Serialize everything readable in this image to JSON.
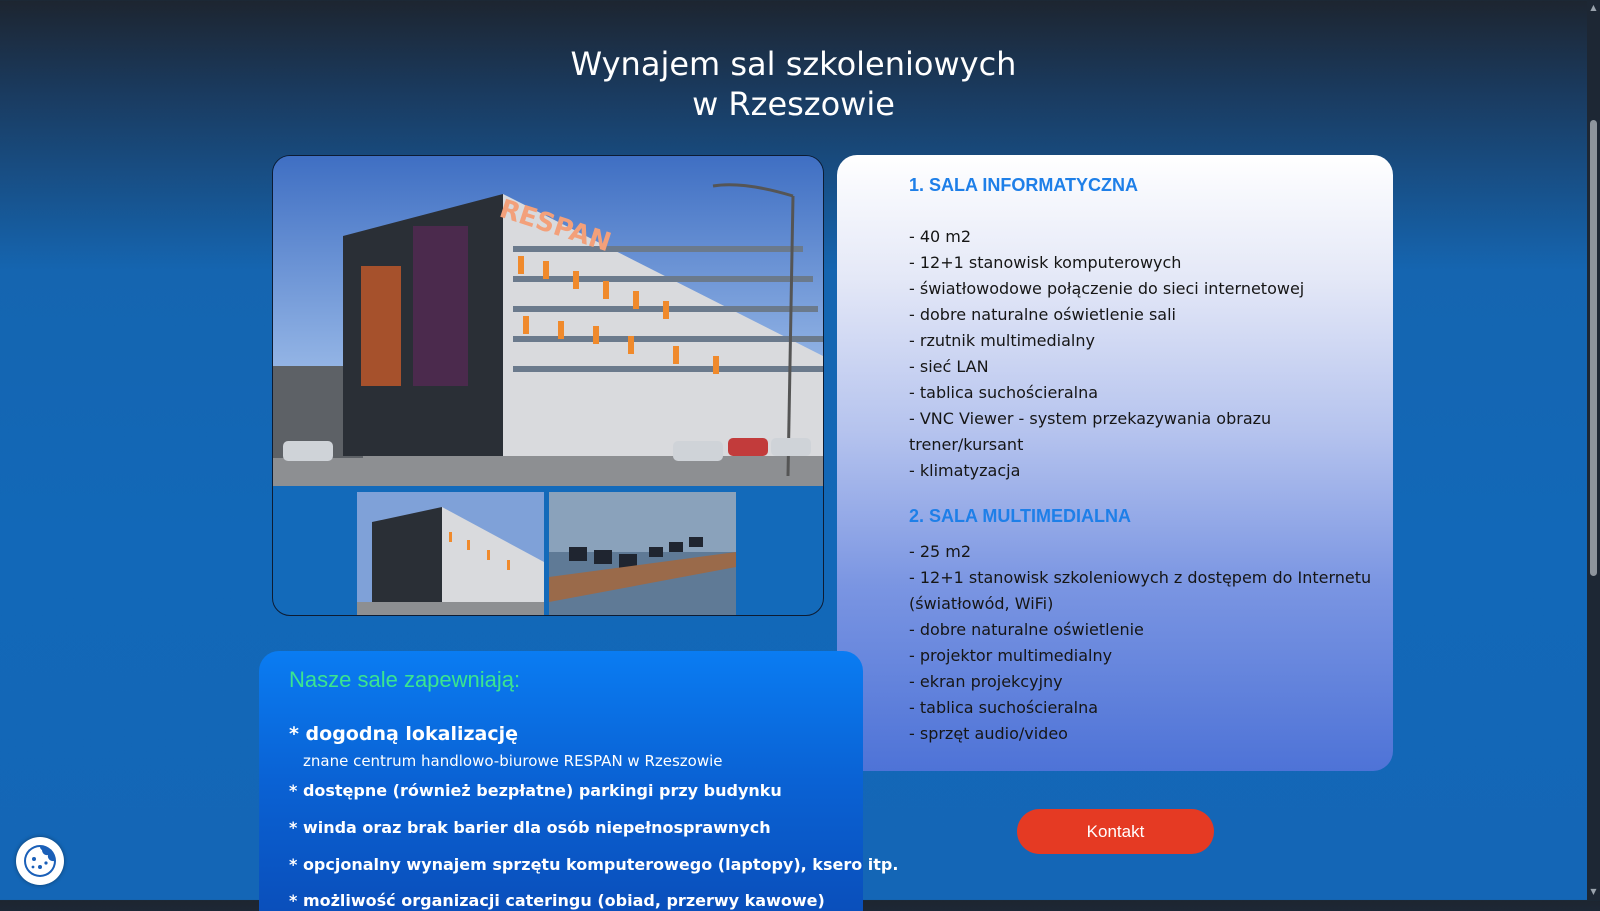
{
  "page": {
    "title_line1": "Wynajem sal szkoleniowych",
    "title_line2": "w Rzeszowie"
  },
  "gallery": {
    "photo_alt": "Budynek RESPAN",
    "building_sign": "RESPAN",
    "thumbnails": [
      "Budynek RESPAN",
      "Sala informatyczna"
    ]
  },
  "sale": [
    {
      "heading": "1. SALA INFORMATYCZNA",
      "features": [
        "- 40 m2",
        "- 12+1 stanowisk komputerowych",
        "- światłowodowe połączenie do sieci internetowej",
        "- dobre naturalne oświetlenie sali",
        "- rzutnik multimedialny",
        "- sieć LAN",
        "- tablica suchościeralna",
        "- VNC Viewer - system przekazywania obrazu trener/kursant",
        "- klimatyzacja"
      ]
    },
    {
      "heading": "2. SALA MULTIMEDIALNA",
      "features": [
        "- 25 m2",
        "- 12+1 stanowisk szkoleniowych z dostępem do Internetu (światłowód, WiFi)",
        "- dobre naturalne oświetlenie",
        "- projektor multimedialny",
        "- ekran projekcyjny",
        "- tablica suchościeralna",
        "- sprzęt audio/video"
      ]
    }
  ],
  "zapewniaja": {
    "title": "Nasze sale zapewniają:",
    "item1": "* dogodną lokalizację",
    "item1_sub": "znane centrum handlowo-biurowe RESPAN w Rzeszowie",
    "item2": "* dostępne (również bezpłatne) parkingi przy budynku",
    "item3": "* winda oraz brak barier dla osób niepełnosprawnych",
    "item4": "* opcjonalny wynajem sprzętu komputerowego (laptopy), ksero itp.",
    "item5": "* możliwość organizacji cateringu (obiad, przerwy kawowe)"
  },
  "buttons": {
    "kontakt": "Kontakt"
  },
  "icons": {
    "cookie": "cookie-icon"
  },
  "colors": {
    "heading_blue": "#1e7fe8",
    "features_title_green": "#3be58f",
    "kontakt_red": "#e53a23"
  }
}
